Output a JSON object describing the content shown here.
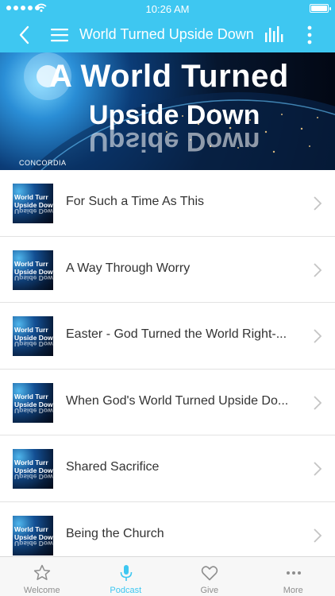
{
  "status_bar": {
    "time": "10:26 AM"
  },
  "nav": {
    "title": "World Turned Upside Down",
    "back_icon": "chevron-left-icon",
    "menu_icon": "hamburger-menu-icon",
    "audio_icon": "audio-bars-icon",
    "more_icon": "kebab-menu-icon"
  },
  "hero": {
    "title_line1": "A World Turned",
    "title_line2": "Upside Down",
    "title_line2_reflection": "Upside Down",
    "logo_text": "CONCORDIA"
  },
  "thumbnail": {
    "line1": "World Turr",
    "line2": "Upside Dow",
    "line3": "Upside Dow"
  },
  "episodes": [
    {
      "title": "For Such a Time As This"
    },
    {
      "title": "A Way Through Worry"
    },
    {
      "title": "Easter - God Turned the World Right-..."
    },
    {
      "title": "When God's World Turned Upside Do..."
    },
    {
      "title": "Shared Sacrifice"
    },
    {
      "title": "Being the Church"
    }
  ],
  "tabs": [
    {
      "label": "Welcome",
      "icon": "star-icon",
      "active": false
    },
    {
      "label": "Podcast",
      "icon": "microphone-icon",
      "active": true
    },
    {
      "label": "Give",
      "icon": "heart-icon",
      "active": false
    },
    {
      "label": "More",
      "icon": "more-dots-icon",
      "active": false
    }
  ],
  "colors": {
    "accent": "#3ec7f1",
    "tab_inactive": "#8e8e8e",
    "row_text": "#333333"
  }
}
